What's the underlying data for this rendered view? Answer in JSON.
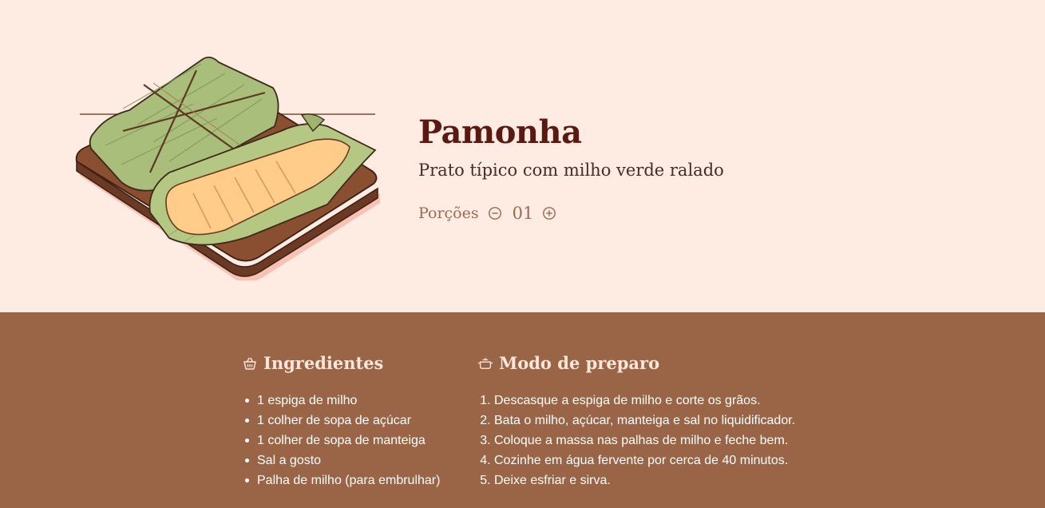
{
  "recipe": {
    "title": "Pamonha",
    "subtitle": "Prato típico com milho verde ralado",
    "image_icon": "pamonha-illustration"
  },
  "servings": {
    "label": "Porções",
    "count": "01",
    "decrease_icon": "minus-circle-icon",
    "increase_icon": "plus-circle-icon"
  },
  "ingredients": {
    "title": "Ingredientes",
    "icon": "basket-icon",
    "items": [
      "1 espiga de milho",
      "1 colher de sopa de açúcar",
      "1 colher de sopa de manteiga",
      "Sal a gosto",
      "Palha de milho (para embrulhar)"
    ]
  },
  "preparation": {
    "title": "Modo de preparo",
    "icon": "cooking-pot-icon",
    "steps": [
      "Descasque a espiga de milho e corte os grãos.",
      "Bata o milho, açúcar, manteiga e sal no liquidificador.",
      "Coloque a massa nas palhas de milho e feche bem.",
      "Cozinhe em água fervente por cerca de 40 minutos.",
      "Deixe esfriar e sirva."
    ]
  },
  "colors": {
    "page_background": "#FEEBE1",
    "content_background": "#9A6446",
    "title": "#5A1A14",
    "section_heading": "#FDE7DA",
    "muted": "#9A6A55"
  }
}
